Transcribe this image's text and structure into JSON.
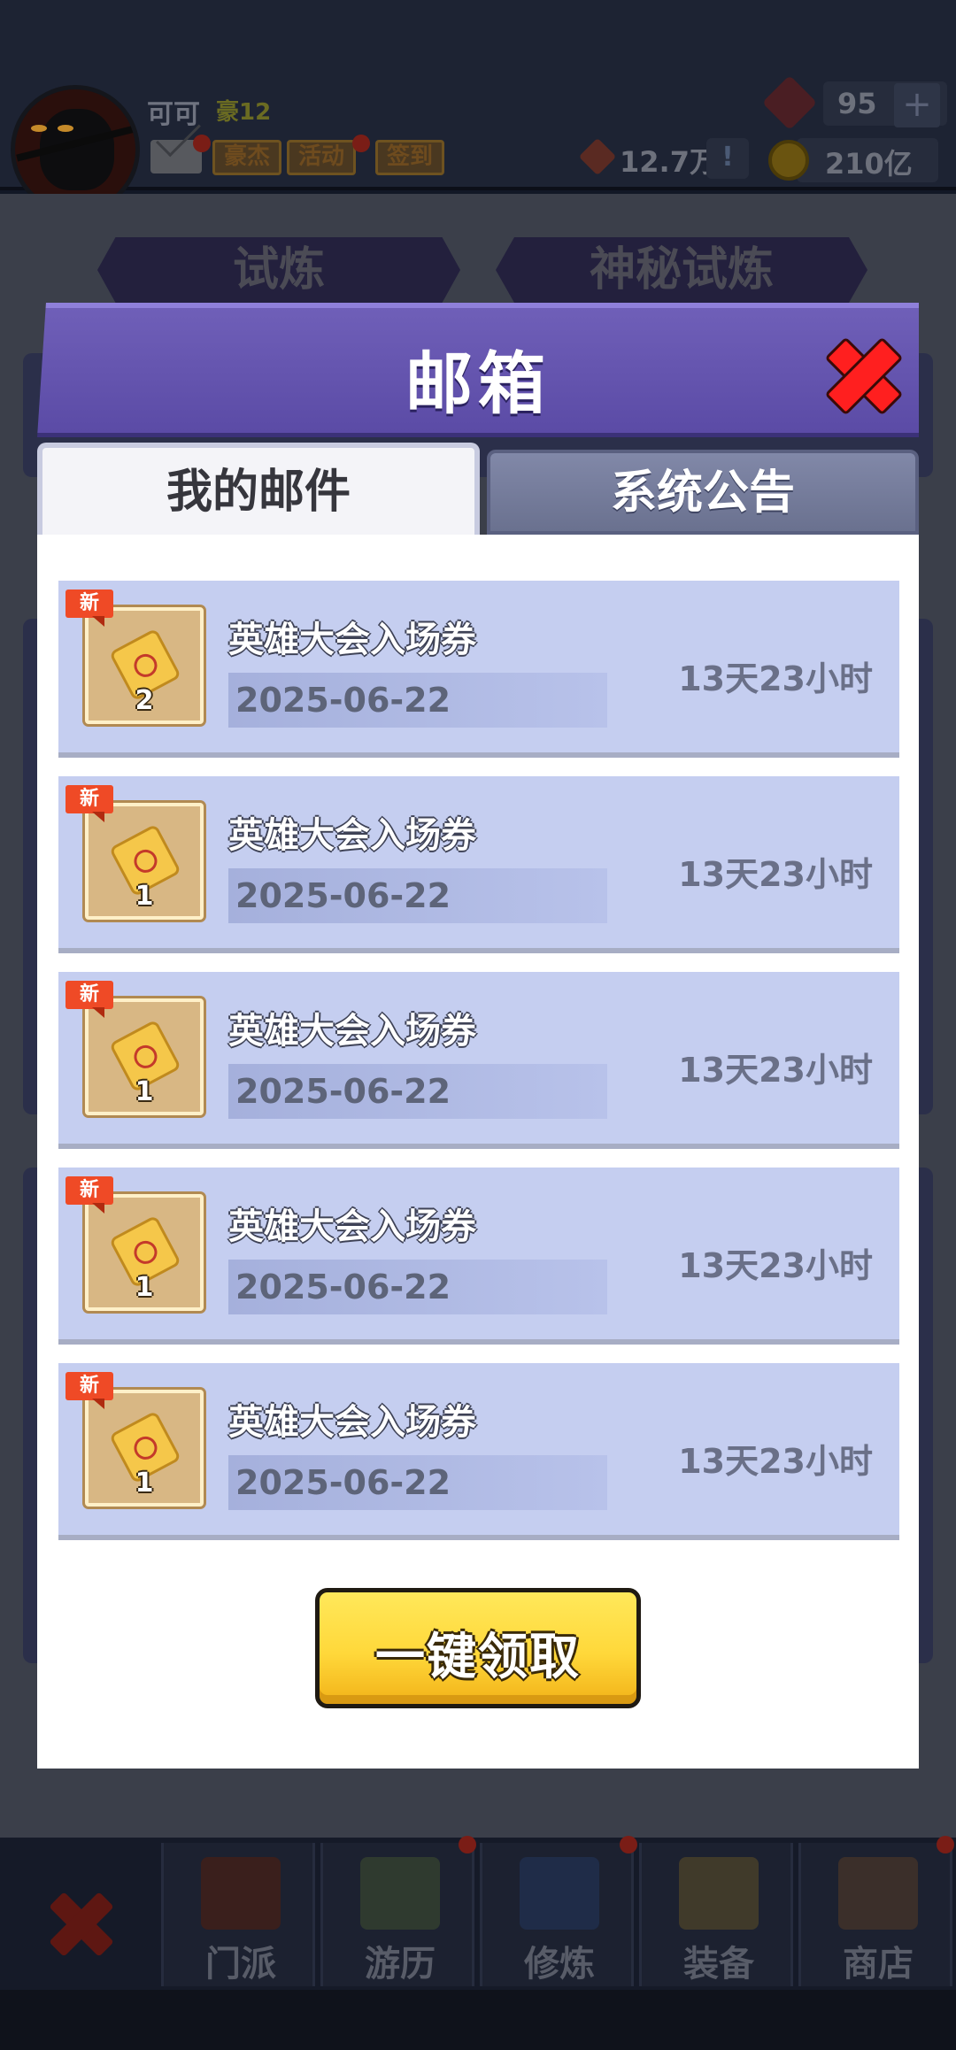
{
  "top_bar": {
    "player_name": "可可",
    "player_level": "豪12",
    "buttons": [
      "豪杰",
      "活动",
      "签到"
    ],
    "gem_count": "95",
    "token_amount": "12.7万",
    "gold_amount": "210亿",
    "plus_label": "+",
    "info_label": "!"
  },
  "background_tabs": [
    "试炼",
    "神秘试炼"
  ],
  "modal": {
    "title": "邮箱",
    "tabs": {
      "my_mail": "我的邮件",
      "system_notice": "系统公告"
    },
    "mail_items": [
      {
        "badge": "新",
        "title": "英雄大会入场券",
        "quantity": "2",
        "date": "2025-06-22",
        "remaining": "13天23小时"
      },
      {
        "badge": "新",
        "title": "英雄大会入场券",
        "quantity": "1",
        "date": "2025-06-22",
        "remaining": "13天23小时"
      },
      {
        "badge": "新",
        "title": "英雄大会入场券",
        "quantity": "1",
        "date": "2025-06-22",
        "remaining": "13天23小时"
      },
      {
        "badge": "新",
        "title": "英雄大会入场券",
        "quantity": "1",
        "date": "2025-06-22",
        "remaining": "13天23小时"
      },
      {
        "badge": "新",
        "title": "英雄大会入场券",
        "quantity": "1",
        "date": "2025-06-22",
        "remaining": "13天23小时"
      }
    ],
    "claim_all_label": "一键领取"
  },
  "bottom_nav": [
    "门派",
    "游历",
    "修炼",
    "装备",
    "商店"
  ],
  "icons": {
    "close": "close-icon",
    "mail": "mail-icon",
    "gem": "gem-icon",
    "coin": "coin-icon",
    "ticket": "ticket-icon"
  },
  "colors": {
    "header_purple": "#5b4ba6",
    "item_bg": "#c5cef0",
    "new_badge": "#ef4a26",
    "claim_button": "#ffd83a",
    "close_red": "#ff1f1f"
  }
}
